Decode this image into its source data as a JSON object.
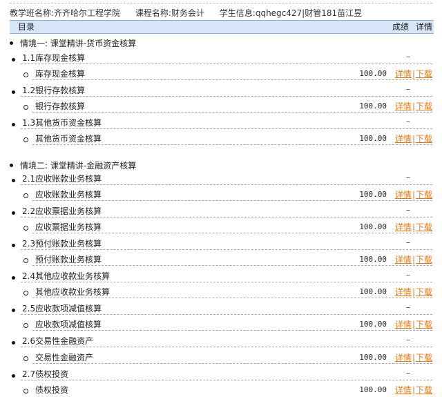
{
  "info": {
    "class_label": "教学班名称:",
    "class_value": "齐齐哈尔工程学院",
    "course_label": "课程名称:",
    "course_value": "财务会计",
    "student_label": "学生信息:",
    "student_value": "qqhegc427|财管181苗江昱"
  },
  "header": {
    "title": "目录",
    "score": "成绩",
    "detail": "详情"
  },
  "sections": [
    {
      "title": "情境一: 课堂精讲-货币资金核算",
      "chapters": [
        {
          "label": "1.1库存现金核算",
          "status": "–",
          "item": {
            "label": "库存现金核算",
            "score": "100.00",
            "detail": "详情",
            "download": "下载"
          }
        },
        {
          "label": "1.2银行存款核算",
          "status": "–",
          "item": {
            "label": "银行存款核算",
            "score": "100.00",
            "detail": "详情",
            "download": "下载"
          }
        },
        {
          "label": "1.3其他货币资金核算",
          "status": "–",
          "item": {
            "label": "其他货币资金核算",
            "score": "100.00",
            "detail": "详情",
            "download": "下载"
          }
        }
      ]
    },
    {
      "title": "情境二: 课堂精讲-金融资产核算",
      "chapters": [
        {
          "label": "2.1应收账款业务核算",
          "status": "–",
          "item": {
            "label": "应收账款业务核算",
            "score": "100.00",
            "detail": "详情",
            "download": "下载"
          }
        },
        {
          "label": "2.2应收票据业务核算",
          "status": "–",
          "item": {
            "label": "应收票据业务核算",
            "score": "100.00",
            "detail": "详情",
            "download": "下载"
          }
        },
        {
          "label": "2.3预付账款业务核算",
          "status": "–",
          "item": {
            "label": "预付账款业务核算",
            "score": "100.00",
            "detail": "详情",
            "download": "下载"
          }
        },
        {
          "label": "2.4其他应收款业务核算",
          "status": "–",
          "item": {
            "label": "其他应收款业务核算",
            "score": "100.00",
            "detail": "详情",
            "download": "下载"
          }
        },
        {
          "label": "2.5应收款项减值核算",
          "status": "–",
          "item": {
            "label": "应收款项减值核算",
            "score": "100.00",
            "detail": "详情",
            "download": "下载"
          }
        },
        {
          "label": "2.6交易性金融资产",
          "status": "–",
          "item": {
            "label": "交易性金融资产",
            "score": "100.00",
            "detail": "详情",
            "download": "下载"
          }
        },
        {
          "label": "2.7债权投资",
          "status": "–",
          "item": {
            "label": "债权投资",
            "score": "100.00",
            "detail": "详情",
            "download": "下载"
          }
        }
      ]
    }
  ],
  "colors": {
    "link": "#e07b1a",
    "header_bg": "#d6e6f8"
  }
}
